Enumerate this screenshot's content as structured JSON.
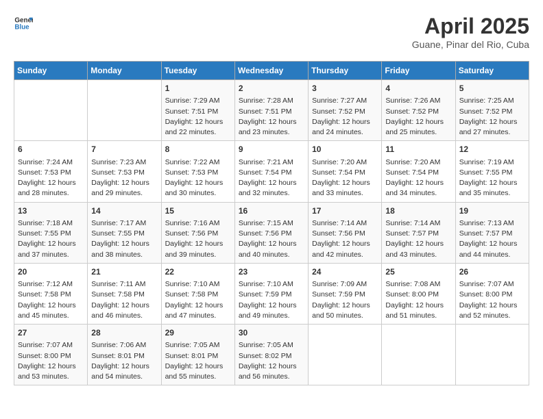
{
  "header": {
    "logo_line1": "General",
    "logo_line2": "Blue",
    "title": "April 2025",
    "subtitle": "Guane, Pinar del Rio, Cuba"
  },
  "days_of_week": [
    "Sunday",
    "Monday",
    "Tuesday",
    "Wednesday",
    "Thursday",
    "Friday",
    "Saturday"
  ],
  "weeks": [
    [
      {
        "day": "",
        "info": ""
      },
      {
        "day": "",
        "info": ""
      },
      {
        "day": "1",
        "info": "Sunrise: 7:29 AM\nSunset: 7:51 PM\nDaylight: 12 hours\nand 22 minutes."
      },
      {
        "day": "2",
        "info": "Sunrise: 7:28 AM\nSunset: 7:51 PM\nDaylight: 12 hours\nand 23 minutes."
      },
      {
        "day": "3",
        "info": "Sunrise: 7:27 AM\nSunset: 7:52 PM\nDaylight: 12 hours\nand 24 minutes."
      },
      {
        "day": "4",
        "info": "Sunrise: 7:26 AM\nSunset: 7:52 PM\nDaylight: 12 hours\nand 25 minutes."
      },
      {
        "day": "5",
        "info": "Sunrise: 7:25 AM\nSunset: 7:52 PM\nDaylight: 12 hours\nand 27 minutes."
      }
    ],
    [
      {
        "day": "6",
        "info": "Sunrise: 7:24 AM\nSunset: 7:53 PM\nDaylight: 12 hours\nand 28 minutes."
      },
      {
        "day": "7",
        "info": "Sunrise: 7:23 AM\nSunset: 7:53 PM\nDaylight: 12 hours\nand 29 minutes."
      },
      {
        "day": "8",
        "info": "Sunrise: 7:22 AM\nSunset: 7:53 PM\nDaylight: 12 hours\nand 30 minutes."
      },
      {
        "day": "9",
        "info": "Sunrise: 7:21 AM\nSunset: 7:54 PM\nDaylight: 12 hours\nand 32 minutes."
      },
      {
        "day": "10",
        "info": "Sunrise: 7:20 AM\nSunset: 7:54 PM\nDaylight: 12 hours\nand 33 minutes."
      },
      {
        "day": "11",
        "info": "Sunrise: 7:20 AM\nSunset: 7:54 PM\nDaylight: 12 hours\nand 34 minutes."
      },
      {
        "day": "12",
        "info": "Sunrise: 7:19 AM\nSunset: 7:55 PM\nDaylight: 12 hours\nand 35 minutes."
      }
    ],
    [
      {
        "day": "13",
        "info": "Sunrise: 7:18 AM\nSunset: 7:55 PM\nDaylight: 12 hours\nand 37 minutes."
      },
      {
        "day": "14",
        "info": "Sunrise: 7:17 AM\nSunset: 7:55 PM\nDaylight: 12 hours\nand 38 minutes."
      },
      {
        "day": "15",
        "info": "Sunrise: 7:16 AM\nSunset: 7:56 PM\nDaylight: 12 hours\nand 39 minutes."
      },
      {
        "day": "16",
        "info": "Sunrise: 7:15 AM\nSunset: 7:56 PM\nDaylight: 12 hours\nand 40 minutes."
      },
      {
        "day": "17",
        "info": "Sunrise: 7:14 AM\nSunset: 7:56 PM\nDaylight: 12 hours\nand 42 minutes."
      },
      {
        "day": "18",
        "info": "Sunrise: 7:14 AM\nSunset: 7:57 PM\nDaylight: 12 hours\nand 43 minutes."
      },
      {
        "day": "19",
        "info": "Sunrise: 7:13 AM\nSunset: 7:57 PM\nDaylight: 12 hours\nand 44 minutes."
      }
    ],
    [
      {
        "day": "20",
        "info": "Sunrise: 7:12 AM\nSunset: 7:58 PM\nDaylight: 12 hours\nand 45 minutes."
      },
      {
        "day": "21",
        "info": "Sunrise: 7:11 AM\nSunset: 7:58 PM\nDaylight: 12 hours\nand 46 minutes."
      },
      {
        "day": "22",
        "info": "Sunrise: 7:10 AM\nSunset: 7:58 PM\nDaylight: 12 hours\nand 47 minutes."
      },
      {
        "day": "23",
        "info": "Sunrise: 7:10 AM\nSunset: 7:59 PM\nDaylight: 12 hours\nand 49 minutes."
      },
      {
        "day": "24",
        "info": "Sunrise: 7:09 AM\nSunset: 7:59 PM\nDaylight: 12 hours\nand 50 minutes."
      },
      {
        "day": "25",
        "info": "Sunrise: 7:08 AM\nSunset: 8:00 PM\nDaylight: 12 hours\nand 51 minutes."
      },
      {
        "day": "26",
        "info": "Sunrise: 7:07 AM\nSunset: 8:00 PM\nDaylight: 12 hours\nand 52 minutes."
      }
    ],
    [
      {
        "day": "27",
        "info": "Sunrise: 7:07 AM\nSunset: 8:00 PM\nDaylight: 12 hours\nand 53 minutes."
      },
      {
        "day": "28",
        "info": "Sunrise: 7:06 AM\nSunset: 8:01 PM\nDaylight: 12 hours\nand 54 minutes."
      },
      {
        "day": "29",
        "info": "Sunrise: 7:05 AM\nSunset: 8:01 PM\nDaylight: 12 hours\nand 55 minutes."
      },
      {
        "day": "30",
        "info": "Sunrise: 7:05 AM\nSunset: 8:02 PM\nDaylight: 12 hours\nand 56 minutes."
      },
      {
        "day": "",
        "info": ""
      },
      {
        "day": "",
        "info": ""
      },
      {
        "day": "",
        "info": ""
      }
    ]
  ]
}
